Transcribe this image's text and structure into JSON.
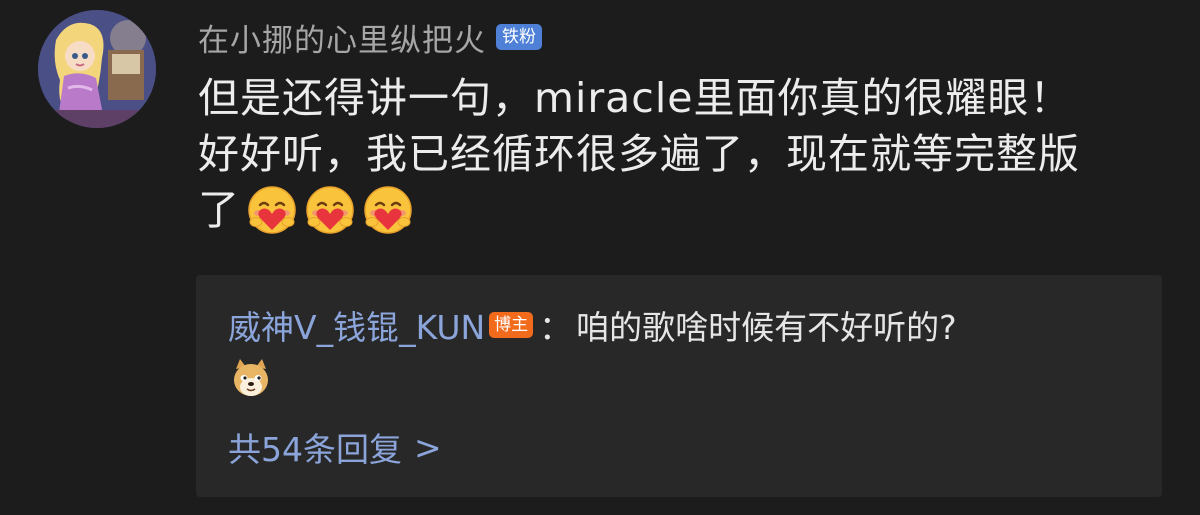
{
  "comment": {
    "username": "在小挪的心里纵把火",
    "fan_badge": "铁粉",
    "lines": [
      "但是还得讲一句，miracle里面你真的很耀眼！",
      "好好听，我已经循环很多遍了，现在就等完整版",
      "了"
    ],
    "trailing_emoji": "hug-heart-emoji",
    "trailing_emoji_count": 3
  },
  "reply": {
    "author": "威神V_钱锟_KUN",
    "author_badge": "博主",
    "separator": "：",
    "text": "咱的歌啥时候有不好听的?",
    "emoji": "doge-emoji",
    "count_label": "共54条回复",
    "chevron": ">"
  },
  "colors": {
    "background": "#1c1c1c",
    "reply_box": "#282828",
    "username": "#a6a6a6",
    "link_blue": "#8ba5db",
    "fan_badge": "#4d80d6",
    "host_badge": "#f26a1b",
    "text": "#ececec"
  }
}
